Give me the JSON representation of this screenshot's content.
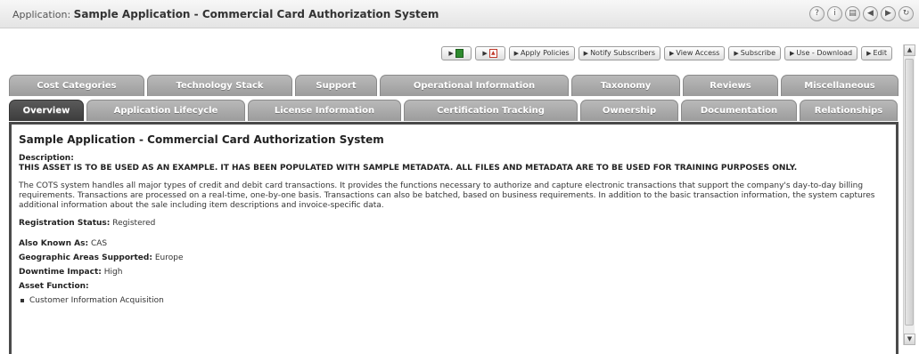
{
  "titlebar": {
    "prefix": "Application:",
    "title": "Sample Application - Commercial Card Authorization System",
    "icons": [
      "help-icon",
      "info-icon",
      "print-icon",
      "back-icon",
      "forward-icon",
      "refresh-icon"
    ]
  },
  "actions": {
    "buttons": [
      {
        "label": "Apply Policies"
      },
      {
        "label": "Notify Subscribers"
      },
      {
        "label": "View Access"
      },
      {
        "label": "Subscribe"
      },
      {
        "label": "Use - Download"
      },
      {
        "label": "Edit"
      }
    ]
  },
  "tabs": {
    "back_row": [
      "Cost Categories",
      "Technology Stack",
      "Support",
      "Operational Information",
      "Taxonomy",
      "Reviews",
      "Miscellaneous"
    ],
    "front_row": [
      "Overview",
      "Application Lifecycle",
      "License Information",
      "Certification Tracking",
      "Ownership",
      "Documentation",
      "Relationships"
    ],
    "active": "Overview"
  },
  "content": {
    "heading": "Sample Application - Commercial Card Authorization System",
    "description_label": "Description:",
    "description_caps": "THIS ASSET IS TO BE USED AS AN EXAMPLE. IT HAS BEEN POPULATED WITH SAMPLE METADATA. ALL FILES AND METADATA ARE TO BE USED FOR TRAINING PURPOSES ONLY.",
    "paragraph": "The COTS system handles all major types of credit and debit card transactions. It provides the functions necessary to authorize and capture electronic transactions that support the company's day-to-day billing requirements. Transactions are processed on a real-time, one-by-one basis. Transactions can also be batched, based on business requirements. In addition to the basic transaction information, the system captures additional information about the sale including item descriptions and invoice-specific data.",
    "registration_label": "Registration Status:",
    "registration_value": "Registered",
    "aka_label": "Also Known As:",
    "aka_value": "CAS",
    "geo_label": "Geographic Areas Supported:",
    "geo_value": "Europe",
    "downtime_label": "Downtime Impact:",
    "downtime_value": "High",
    "function_label": "Asset Function:",
    "function_items": [
      "Customer Information Acquisition"
    ]
  }
}
